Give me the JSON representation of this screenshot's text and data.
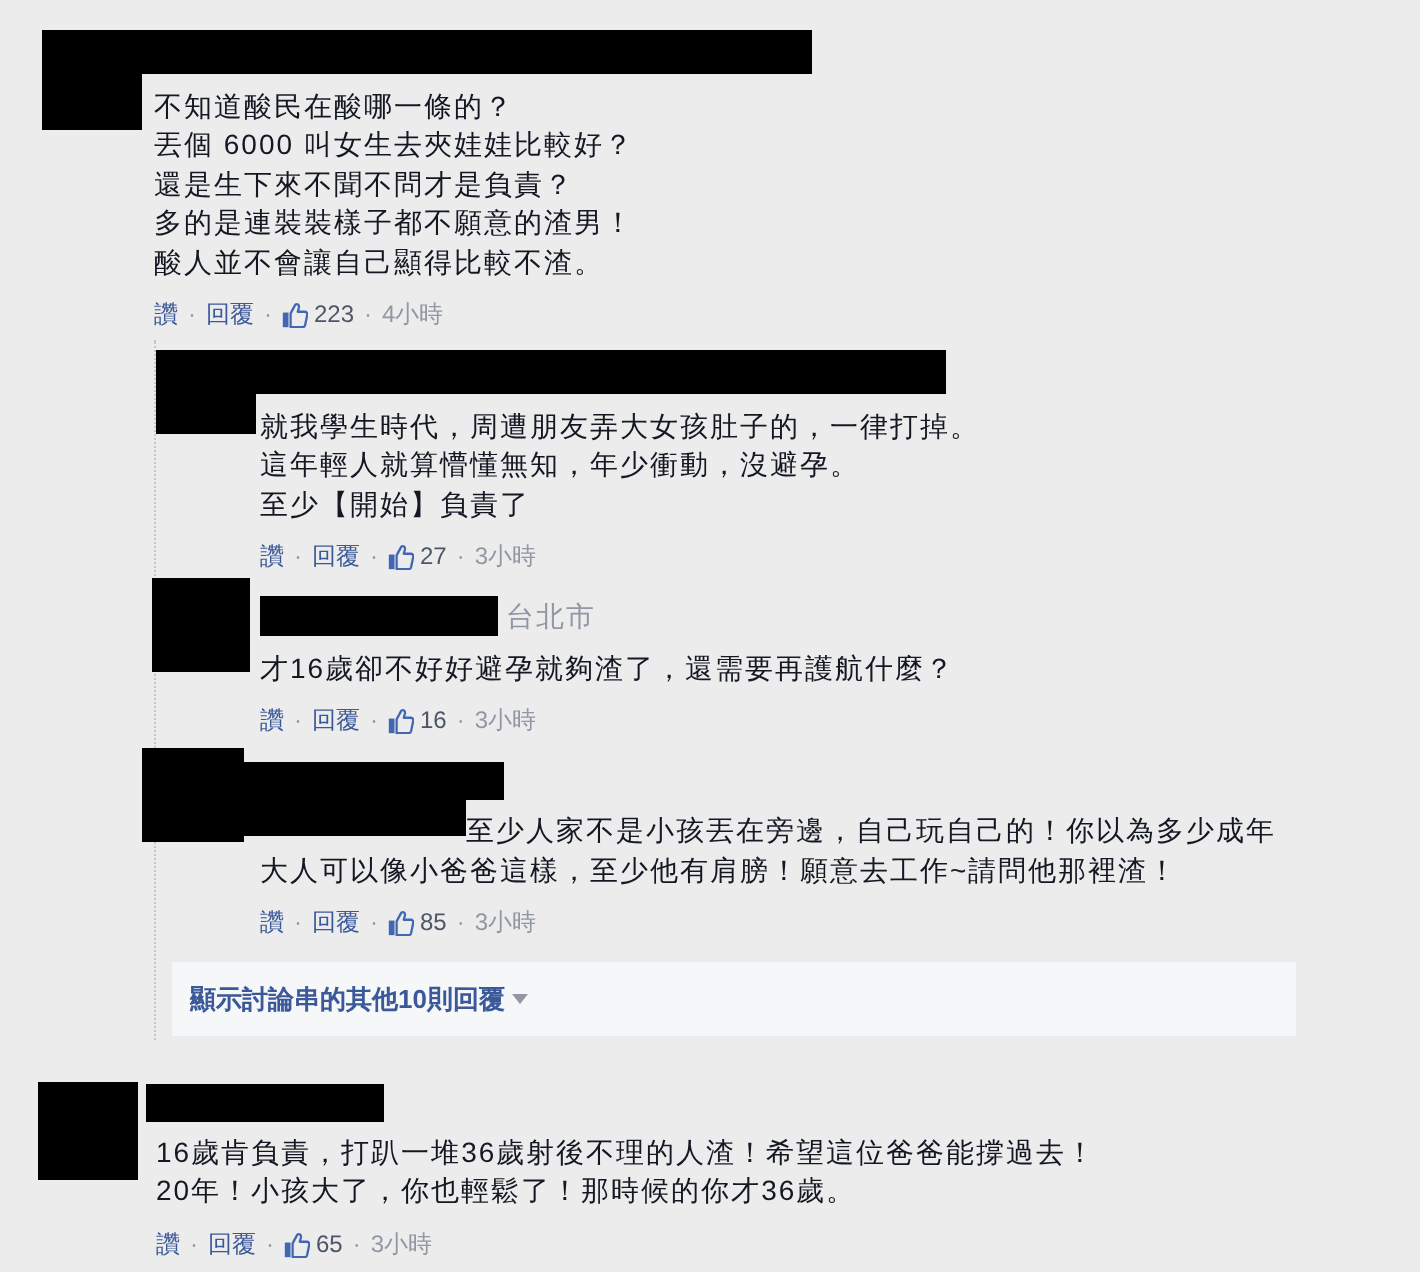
{
  "comments": [
    {
      "lines": [
        "不知道酸民在酸哪一條的？",
        "丟個 6000 叫女生去夾娃娃比較好？",
        "還是生下來不聞不問才是負責？",
        "多的是連裝裝樣子都不願意的渣男！",
        "酸人並不會讓自己顯得比較不渣。"
      ],
      "actions": [
        {
          "kind": "link",
          "text": "讚"
        },
        {
          "kind": "separator",
          "text": "·"
        },
        {
          "kind": "link",
          "text": "回覆"
        },
        {
          "kind": "separator",
          "text": "·"
        },
        {
          "kind": "likes",
          "text": "223"
        },
        {
          "kind": "separator",
          "text": "·"
        },
        {
          "kind": "time",
          "text": "4小時"
        }
      ],
      "replies": [
        {
          "lines": [
            "就我學生時代，周遭朋友弄大女孩肚子的，一律打掉。",
            "這年輕人就算懵懂無知，年少衝動，沒避孕。",
            "至少【開始】負責了"
          ],
          "actions": [
            {
              "kind": "link",
              "text": "讚"
            },
            {
              "kind": "separator",
              "text": "·"
            },
            {
              "kind": "link",
              "text": "回覆"
            },
            {
              "kind": "separator",
              "text": "·"
            },
            {
              "kind": "likes",
              "text": "27"
            },
            {
              "kind": "separator",
              "text": "·"
            },
            {
              "kind": "time",
              "text": "3小時"
            }
          ]
        },
        {
          "location": "台北市",
          "lines": [
            "才16歲卻不好好避孕就夠渣了，還需要再護航什麼？"
          ],
          "actions": [
            {
              "kind": "link",
              "text": "讚"
            },
            {
              "kind": "separator",
              "text": "·"
            },
            {
              "kind": "link",
              "text": "回覆"
            },
            {
              "kind": "separator",
              "text": "·"
            },
            {
              "kind": "likes",
              "text": "16"
            },
            {
              "kind": "separator",
              "text": "·"
            },
            {
              "kind": "time",
              "text": "3小時"
            }
          ]
        },
        {
          "mention_redacted": true,
          "lines": [
            "至少人家不是小孩丟在旁邊，自己玩自己的！你以為多少成年",
            "大人可以像小爸爸這樣，至少他有肩膀！願意去工作~請問他那裡渣！"
          ],
          "actions": [
            {
              "kind": "link",
              "text": "讚"
            },
            {
              "kind": "separator",
              "text": "·"
            },
            {
              "kind": "link",
              "text": "回覆"
            },
            {
              "kind": "separator",
              "text": "·"
            },
            {
              "kind": "likes",
              "text": "85"
            },
            {
              "kind": "separator",
              "text": "·"
            },
            {
              "kind": "time",
              "text": "3小時"
            }
          ]
        }
      ],
      "more_replies": {
        "label": "顯示討論串的其他10則回覆"
      }
    },
    {
      "lines": [
        "16歲肯負責，打趴一堆36歲射後不理的人渣！希望這位爸爸能撐過去！",
        "20年！小孩大了，你也輕鬆了！那時候的你才36歲。"
      ],
      "actions": [
        {
          "kind": "link",
          "text": "讚"
        },
        {
          "kind": "separator",
          "text": "·"
        },
        {
          "kind": "link",
          "text": "回覆"
        },
        {
          "kind": "separator",
          "text": "·"
        },
        {
          "kind": "likes",
          "text": "65"
        },
        {
          "kind": "separator",
          "text": "·"
        },
        {
          "kind": "time",
          "text": "3小時"
        }
      ]
    }
  ]
}
